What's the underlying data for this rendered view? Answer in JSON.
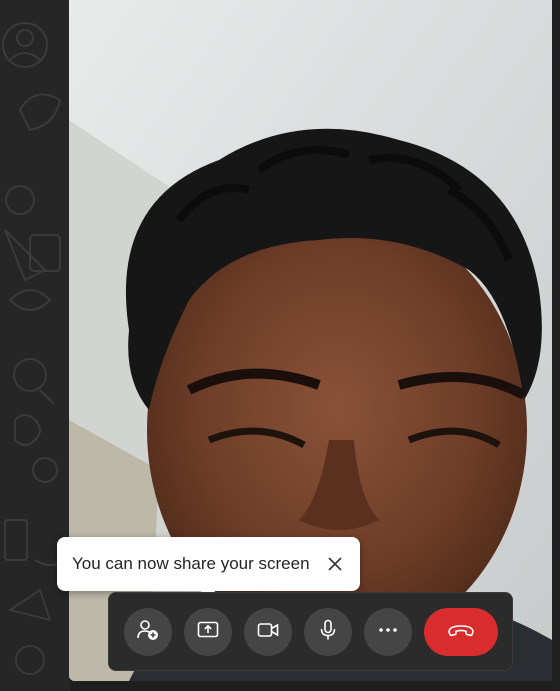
{
  "tooltip": {
    "message": "You can now share your screen",
    "close_icon": "close-icon"
  },
  "controls": {
    "add_participant_icon": "add-person-icon",
    "share_screen_icon": "share-screen-icon",
    "camera_icon": "video-camera-icon",
    "microphone_icon": "microphone-icon",
    "more_icon": "more-icon",
    "end_call_icon": "end-call-icon"
  },
  "colors": {
    "end_call": "#d92c2c",
    "control_bar": "#2b2b2b",
    "control_button": "#454545",
    "tooltip_bg": "#ffffff"
  }
}
